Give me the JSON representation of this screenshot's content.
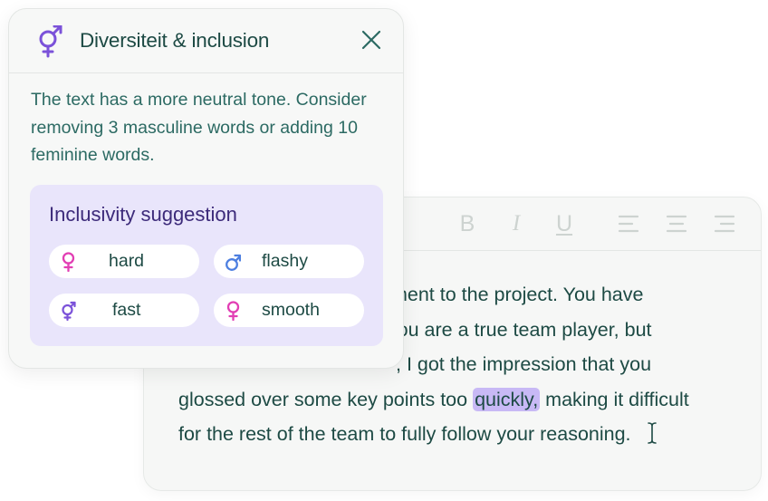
{
  "panel": {
    "title": "Diversiteit & inclusion",
    "description": "The text has a more neutral tone. Consider removing 3 masculine words or adding 10 feminine words.",
    "suggestion_title": "Inclusivity suggestion",
    "chips": [
      {
        "label": "hard",
        "icon": "female-icon"
      },
      {
        "label": "flashy",
        "icon": "male-icon"
      },
      {
        "label": "fast",
        "icon": "gender-fluid-icon"
      },
      {
        "label": "smooth",
        "icon": "female-icon"
      }
    ]
  },
  "editor": {
    "toolbar": {
      "bold": "B",
      "italic": "I",
      "underline": "U"
    },
    "lines": [
      "tment to the project. You have",
      "at you are a true team player, but",
      ", I got the impression that you",
      "glossed over some key points too",
      "making it difficult",
      "for the rest of the team to fully follow your reasoning."
    ],
    "highlight": "quickly,"
  },
  "colors": {
    "accent_purple": "#7b52d9",
    "female_pink": "#e23fb4",
    "male_blue": "#4d7fe0",
    "highlight": "#c8b9f5",
    "text_teal": "#1d4a44"
  }
}
